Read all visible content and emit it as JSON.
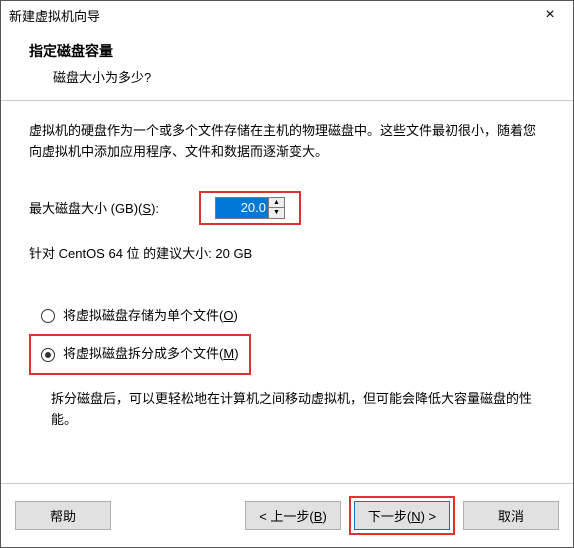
{
  "window": {
    "title": "新建虚拟机向导"
  },
  "header": {
    "title": "指定磁盘容量",
    "subtitle": "磁盘大小为多少?"
  },
  "description": "虚拟机的硬盘作为一个或多个文件存储在主机的物理磁盘中。这些文件最初很小，随着您向虚拟机中添加应用程序、文件和数据而逐渐变大。",
  "size": {
    "label_prefix": "最大磁盘大小 (GB)(",
    "label_key": "S",
    "label_suffix": "):",
    "value": "20.0"
  },
  "recommend": "针对 CentOS 64 位 的建议大小: 20 GB",
  "radio": {
    "single_prefix": "将虚拟磁盘存储为单个文件(",
    "single_key": "O",
    "single_suffix": ")",
    "multi_prefix": "将虚拟磁盘拆分成多个文件(",
    "multi_key": "M",
    "multi_suffix": ")"
  },
  "split_desc": "拆分磁盘后，可以更轻松地在计算机之间移动虚拟机，但可能会降低大容量磁盘的性能。",
  "buttons": {
    "help": "帮助",
    "back_prefix": "< 上一步(",
    "back_key": "B",
    "back_suffix": ")",
    "next_prefix": "下一步(",
    "next_key": "N",
    "next_suffix": ") >",
    "cancel": "取消"
  }
}
